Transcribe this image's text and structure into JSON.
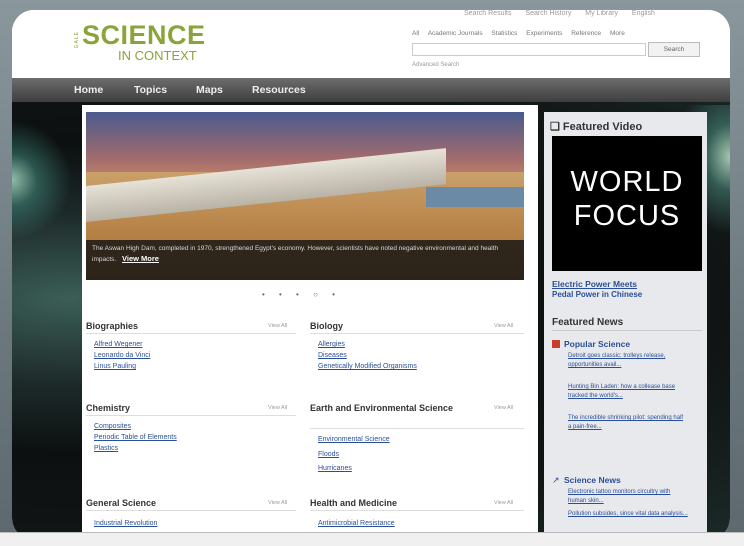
{
  "header": {
    "logo_gale": "GALE",
    "logo_science": "SCIENCE",
    "logo_context": "IN CONTEXT",
    "top_links": [
      "Search Results",
      "Search History",
      "My Library",
      "English"
    ],
    "scope_tabs": [
      "All",
      "Academic Journals",
      "Statistics",
      "Experiments",
      "Reference",
      "More"
    ],
    "search_button": "Search",
    "advanced_search": "Advanced Search"
  },
  "nav": {
    "items": [
      "Home",
      "Topics",
      "Maps",
      "Resources"
    ]
  },
  "hero": {
    "caption": "The Aswan High Dam, completed in 1970, strengthened Egypt's economy. However, scientists have noted negative environmental and health impacts.",
    "more": "View More"
  },
  "carousel_dots": "• • • ○ •",
  "view_all": "View All",
  "sections": {
    "biographies": {
      "title": "Biographies",
      "links": [
        "Alfred Wegener",
        "Leonardo da Vinci",
        "Linus Pauling"
      ]
    },
    "biology": {
      "title": "Biology",
      "links": [
        "Allergies",
        "Diseases",
        "Genetically Modified Organisms"
      ]
    },
    "chemistry": {
      "title": "Chemistry",
      "links": [
        "Composites",
        "Periodic Table of Elements",
        "Plastics"
      ]
    },
    "earth": {
      "title": "Earth and Environmental Science",
      "links": [
        "Environmental Science",
        "Floods",
        "Hurricanes"
      ]
    },
    "general": {
      "title": "General Science",
      "links": [
        "Industrial Revolution"
      ]
    },
    "health": {
      "title": "Health and Medicine",
      "links": [
        "Antimicrobial Resistance"
      ]
    }
  },
  "sidebar": {
    "featured_video_title": "Featured Video",
    "video_line1": "WORLD",
    "video_line2": "FOCUS",
    "video_link1": "Electric Power Meets",
    "video_link2": "Pedal Power in Chinese",
    "featured_news_title": "Featured News",
    "sources": [
      {
        "name": "Popular Science",
        "icon": "popular-science-icon",
        "links": [
          "Detroit goes classic: trolleys release, opportunities avail...",
          "Hunting Bin Laden: how a collease base tracked the world's...",
          "The incredible shrinking pilot: spending half a pain-free..."
        ]
      },
      {
        "name": "Science News",
        "icon": "science-news-icon",
        "links": [
          "Electronic tattoo monitors circuitry with human skin...",
          "Pollution subsides, since vital data analysis..."
        ]
      }
    ]
  }
}
